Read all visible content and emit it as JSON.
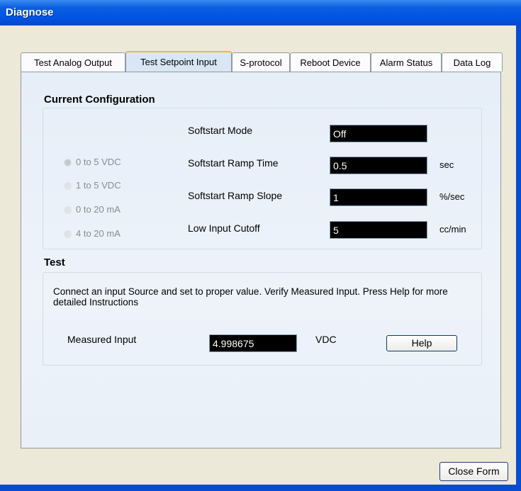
{
  "window": {
    "title": "Diagnose"
  },
  "tabs": [
    {
      "label": "Test Analog Output"
    },
    {
      "label": "Test Setpoint Input"
    },
    {
      "label": "S-protocol"
    },
    {
      "label": "Reboot Device"
    },
    {
      "label": "Alarm Status"
    },
    {
      "label": "Data Log"
    }
  ],
  "active_tab": "Test Setpoint Input",
  "config": {
    "heading": "Current Configuration",
    "radios": [
      {
        "label": "0 to 5 VDC",
        "checked": true
      },
      {
        "label": "1 to 5 VDC",
        "checked": false
      },
      {
        "label": "0 to 20 mA",
        "checked": false
      },
      {
        "label": "4 to 20 mA",
        "checked": false
      }
    ],
    "fields": [
      {
        "label": "Softstart Mode",
        "value": "Off",
        "unit": ""
      },
      {
        "label": "Softstart Ramp Time",
        "value": "0.5",
        "unit": "sec"
      },
      {
        "label": "Softstart Ramp Slope",
        "value": "1",
        "unit": "%/sec"
      },
      {
        "label": "Low Input Cutoff",
        "value": "5",
        "unit": "cc/min"
      }
    ]
  },
  "test": {
    "heading": "Test",
    "instructions": "Connect an input Source and set to proper value. Verify Measured Input. Press Help for more detailed Instructions",
    "measured_label": "Measured Input",
    "measured_value": "4.998675",
    "measured_unit": "VDC",
    "help_label": "Help"
  },
  "footer": {
    "close_label": "Close Form"
  }
}
